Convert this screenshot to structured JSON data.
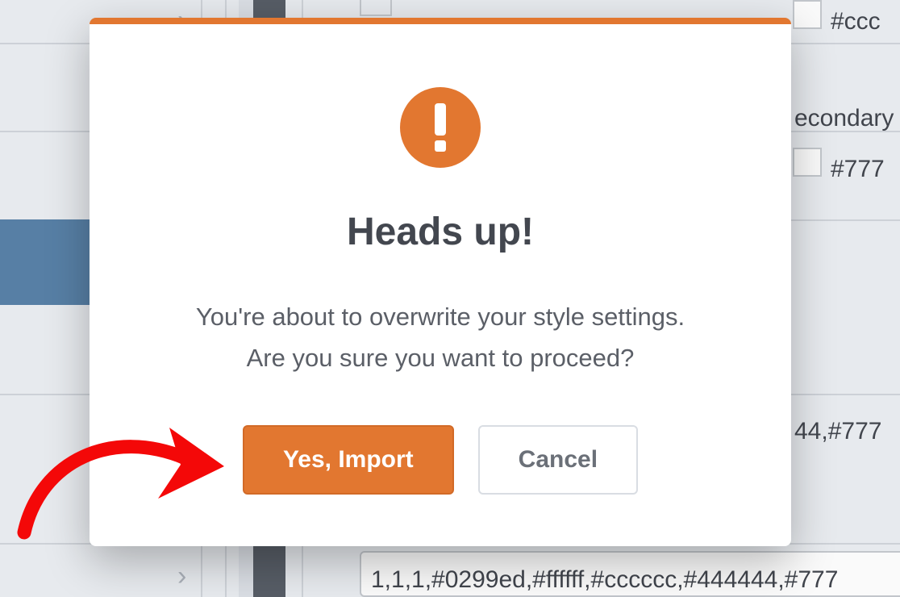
{
  "colors": {
    "accent": "#e27730",
    "annotation": "#f40808"
  },
  "background": {
    "swatch_ccc": "#ccc",
    "label_secondary": "econdary",
    "swatch_777": "#777",
    "fragment_44": "44,#777",
    "long_value": "1,1,1,#0299ed,#ffffff,#cccccc,#444444,#777"
  },
  "modal": {
    "icon": "exclamation-icon",
    "title": "Heads up!",
    "body_line1": "You're about to overwrite your style settings.",
    "body_line2": "Are you sure you want to proceed?",
    "confirm_label": "Yes, Import",
    "cancel_label": "Cancel"
  }
}
